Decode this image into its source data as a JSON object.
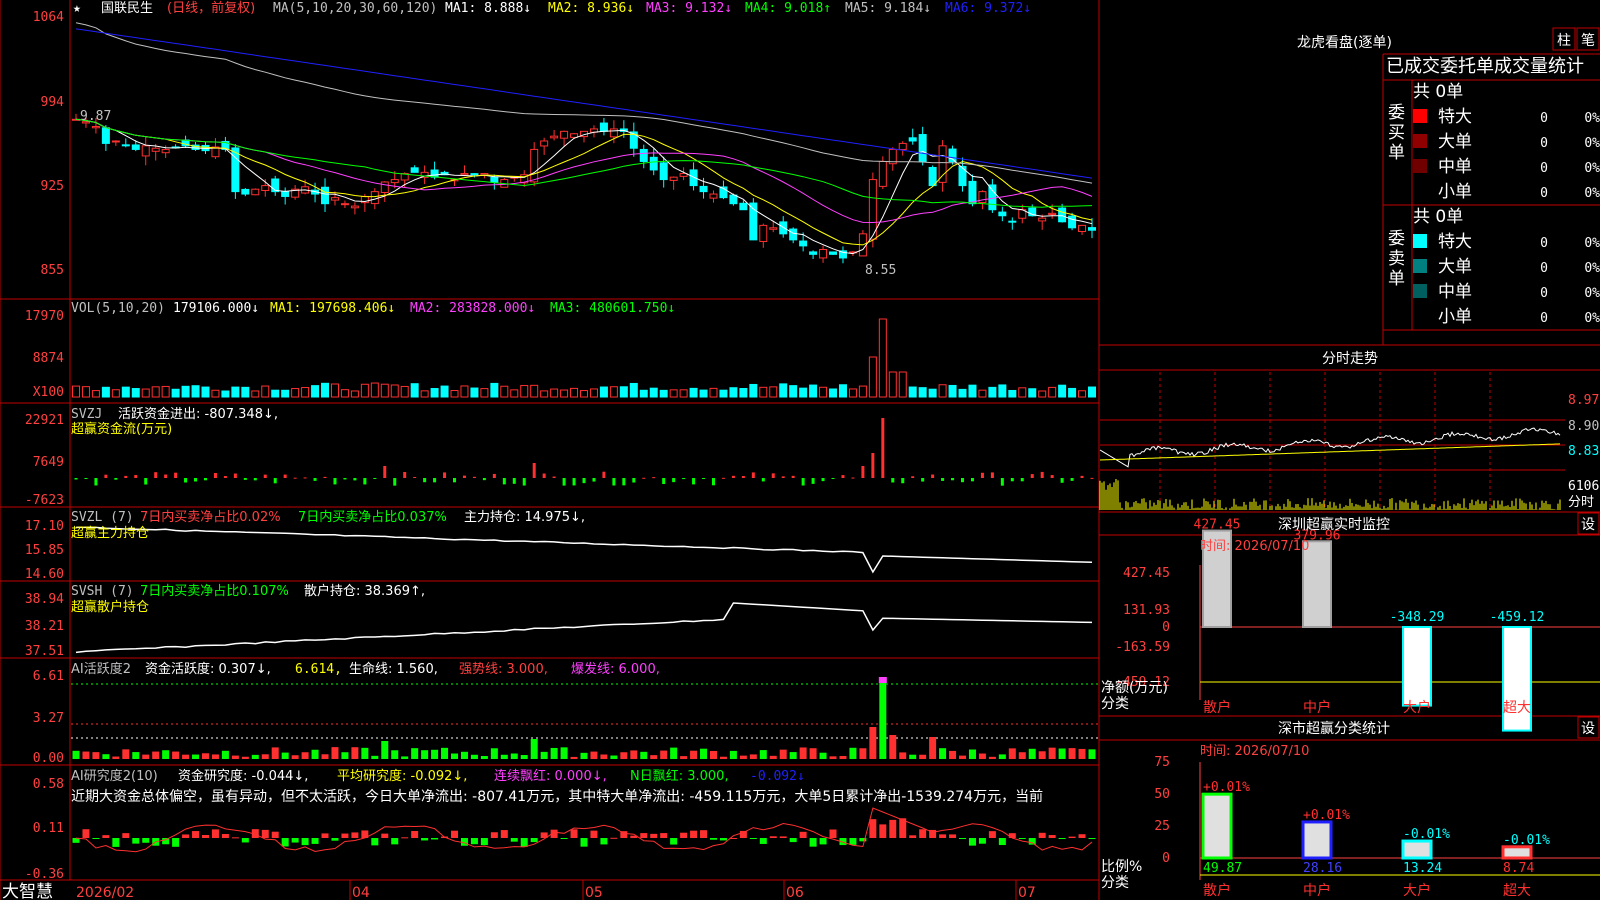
{
  "colors": {
    "up": "#ff3030",
    "down": "#00ffff",
    "grid": "#c00000",
    "axis_text": "#ff4040",
    "white": "#ffffff",
    "yellow": "#ffff00",
    "magenta": "#ff40ff",
    "green": "#00ff00",
    "blue": "#2020ff",
    "gray": "#c0c0c0"
  },
  "header": {
    "star": "★",
    "stock_name": "国联民生",
    "mode": "(日线，前复权)",
    "ma_label": "MA(5,10,20,30,60,120)",
    "ma1": "MA1: 8.888↓",
    "ma2": "MA2: 8.936↓",
    "ma3": "MA3: 9.132↓",
    "ma4": "MA4: 9.018↑",
    "ma5": "MA5: 9.184↓",
    "ma6": "MA6: 9.372↓"
  },
  "price_axis": [
    "1064",
    "994",
    "925",
    "855"
  ],
  "price_marks": {
    "high": "9.87",
    "low": "8.55"
  },
  "vol_header": {
    "label": "VOL(5,10,20)",
    "value": "179106.000↓",
    "ma1": "MA1: 197698.406↓",
    "ma2": "MA2: 283828.000↓",
    "ma3": "MA3: 480601.750↓"
  },
  "vol_axis": [
    "17970",
    "8874",
    "X100"
  ],
  "svzj_header": {
    "label": "SVZJ",
    "text": "活跃资金进出: -807.348↓,",
    "sub": "超赢资金流(万元)"
  },
  "svzj_axis": [
    "22921",
    "7649",
    "-7623"
  ],
  "svzl_header": {
    "label": "SVZL (7)",
    "a": "7日内买卖净占比0.02%",
    "b": "7日内买卖净占比0.037%",
    "c": "主力持仓: 14.975↓,",
    "sub": "超赢主力持仓"
  },
  "svzl_axis": [
    "17.10",
    "15.85",
    "14.60"
  ],
  "svsh_header": {
    "label": "SVSH (7)",
    "a": "7日内买卖净占比0.107%",
    "c": "散户持仓: 38.369↑,",
    "sub": "超赢散户持仓"
  },
  "svsh_axis": [
    "38.94",
    "38.21",
    "37.51"
  ],
  "ai1_header": {
    "label": "AI活跃度2",
    "a": "资金活跃度: 0.307↓,",
    "b": "6.614,",
    "c": "生命线: 1.560,",
    "d": "强势线: 3.000,",
    "e": "爆发线: 6.000,"
  },
  "ai1_axis": [
    "6.61",
    "3.27",
    "0.00"
  ],
  "ai2_header": {
    "label": "AI研究度2(10)",
    "a": "资金研究度: -0.044↓,",
    "b": "平均研究度: -0.092↓,",
    "c": "连续飘红: 0.000↓,",
    "d": "N日飘红: 3.000,",
    "e": "-0.092↓"
  },
  "ai2_axis": [
    "0.58",
    "0.11",
    "-0.36"
  ],
  "ai2_comment": "近期大资金总体偏空，虽有异动，但不太活跃，今日大单净流出: -807.41万元，其中特大单净流出: -459.115万元，大单5日累计净出-1539.274万元，当前",
  "time_axis": {
    "brand": "大智慧",
    "labels": [
      "2026/02",
      "04",
      "05",
      "06",
      "07"
    ]
  },
  "lhb": {
    "title": "龙虎看盘(逐单)",
    "btn1": "柱",
    "btn2": "笔",
    "subtitle": "已成交委托单成交量统计",
    "buy_group": {
      "label": "委买单",
      "total": "共 0单",
      "rows": [
        {
          "name": "特大",
          "v": "0",
          "p": "0%"
        },
        {
          "name": "大单",
          "v": "0",
          "p": "0%"
        },
        {
          "name": "中单",
          "v": "0",
          "p": "0%"
        },
        {
          "name": "小单",
          "v": "0",
          "p": "0%"
        }
      ]
    },
    "sell_group": {
      "label": "委卖单",
      "total": "共 0单",
      "rows": [
        {
          "name": "特大",
          "v": "0",
          "p": "0%"
        },
        {
          "name": "大单",
          "v": "0",
          "p": "0%"
        },
        {
          "name": "中单",
          "v": "0",
          "p": "0%"
        },
        {
          "name": "小单",
          "v": "0",
          "p": "0%"
        }
      ]
    }
  },
  "intraday": {
    "title": "分时走势",
    "axis": [
      "8.97",
      "8.90",
      "8.83",
      "6106",
      "分时"
    ]
  },
  "monitor": {
    "title": "深圳超赢实时监控",
    "set": "设",
    "time": "时间: 2026/07/10",
    "axis": [
      "427.45",
      "131.93",
      "0",
      "-163.59",
      "-459.12"
    ],
    "ylabel": "净额(万元)",
    "xlabel": "分类",
    "categories": [
      "散户",
      "中户",
      "大户",
      "超大"
    ],
    "values": [
      427.45,
      379.96,
      -348.29,
      -459.12
    ],
    "value_labels": [
      "427.45",
      "379.96",
      "-348.29",
      "-459.12"
    ]
  },
  "classify": {
    "title": "深市超赢分类统计",
    "set": "设",
    "time": "时间: 2026/07/10",
    "axis": [
      "75",
      "50",
      "25",
      "0"
    ],
    "ylabel": "比例%",
    "xlabel": "分类",
    "categories": [
      "散户",
      "中户",
      "大户",
      "超大"
    ],
    "values": [
      49.87,
      28.16,
      13.24,
      8.74
    ],
    "changes": [
      "+0.01%",
      "+0.01%",
      "-0.01%",
      "-0.01%"
    ],
    "value_labels": [
      "49.87",
      "28.16",
      "13.24",
      "8.74"
    ]
  },
  "chart_data": [
    {
      "type": "candlestick",
      "title": "国联民生",
      "series_names": [
        "MA1",
        "MA2",
        "MA3",
        "MA4",
        "MA5",
        "MA6"
      ],
      "ylim": [
        8.55,
        10.64
      ],
      "close_last_ma": [
        8.888,
        8.936,
        9.132,
        9.018,
        9.184,
        9.372
      ],
      "x_labels": [
        "2026/02",
        "04",
        "05",
        "06",
        "07"
      ],
      "close": [
        9.8,
        9.78,
        9.74,
        9.6,
        9.62,
        9.58,
        9.55,
        9.58,
        9.56,
        9.55,
        9.57,
        9.58,
        9.55,
        9.54,
        9.57,
        9.55,
        9.2,
        9.18,
        9.22,
        9.25,
        9.2,
        9.16,
        9.22,
        9.24,
        9.18,
        9.1,
        9.15,
        9.1,
        9.08,
        9.16,
        9.2,
        9.28,
        9.3,
        9.35,
        9.36,
        9.36,
        9.32,
        9.34,
        9.3,
        9.35,
        9.34,
        9.35,
        9.28,
        9.3,
        9.32,
        9.34,
        9.55,
        9.62,
        9.66,
        9.7,
        9.68,
        9.7,
        9.72,
        9.7,
        9.72,
        9.7,
        9.56,
        9.45,
        9.38,
        9.3,
        9.32,
        9.35,
        9.25,
        9.2,
        9.18,
        9.15,
        9.1,
        9.05,
        8.8,
        8.92,
        8.9,
        8.85,
        8.8,
        8.75,
        8.68,
        8.72,
        8.68,
        8.65,
        8.7,
        8.85,
        9.3,
        9.45,
        9.55,
        9.6,
        9.62,
        9.45,
        9.25,
        9.58,
        9.45,
        9.25,
        9.1,
        9.2,
        9.05,
        9.0,
        8.95,
        9.05,
        9.0,
        8.98,
        9.02,
        8.95,
        8.9,
        8.92,
        8.88
      ]
    },
    {
      "type": "bar",
      "title": "VOL(5,10,20)",
      "values_last": 179106.0,
      "ma": [
        197698.406,
        283828.0,
        480601.75
      ]
    },
    {
      "type": "bar",
      "title": "SVZJ 活跃资金进出",
      "value_last": -807.348,
      "ylim": [
        -7623,
        22921
      ]
    },
    {
      "type": "line",
      "title": "SVZL 主力持仓",
      "value_last": 14.975,
      "ylim": [
        14.6,
        17.1
      ]
    },
    {
      "type": "line",
      "title": "SVSH 散户持仓",
      "value_last": 38.369,
      "ylim": [
        37.51,
        38.94
      ]
    },
    {
      "type": "bar",
      "title": "AI活跃度2",
      "value_last": 0.307,
      "ylim": [
        0.0,
        6.61
      ],
      "lines": {
        "生命线": 1.56,
        "强势线": 3.0,
        "爆发线": 6.0
      }
    },
    {
      "type": "bar",
      "title": "AI研究度2(10)",
      "value_last": -0.044,
      "avg": -0.092,
      "ylim": [
        -0.36,
        0.58
      ]
    },
    {
      "type": "bar",
      "title": "深圳超赢实时监控",
      "categories": [
        "散户",
        "中户",
        "大户",
        "超大"
      ],
      "values": [
        427.45,
        379.96,
        -348.29,
        -459.12
      ],
      "ylim": [
        -459.12,
        427.45
      ]
    },
    {
      "type": "bar",
      "title": "深市超赢分类统计",
      "categories": [
        "散户",
        "中户",
        "大户",
        "超大"
      ],
      "values": [
        49.87,
        28.16,
        13.24,
        8.74
      ],
      "ylim": [
        0,
        75
      ]
    }
  ]
}
